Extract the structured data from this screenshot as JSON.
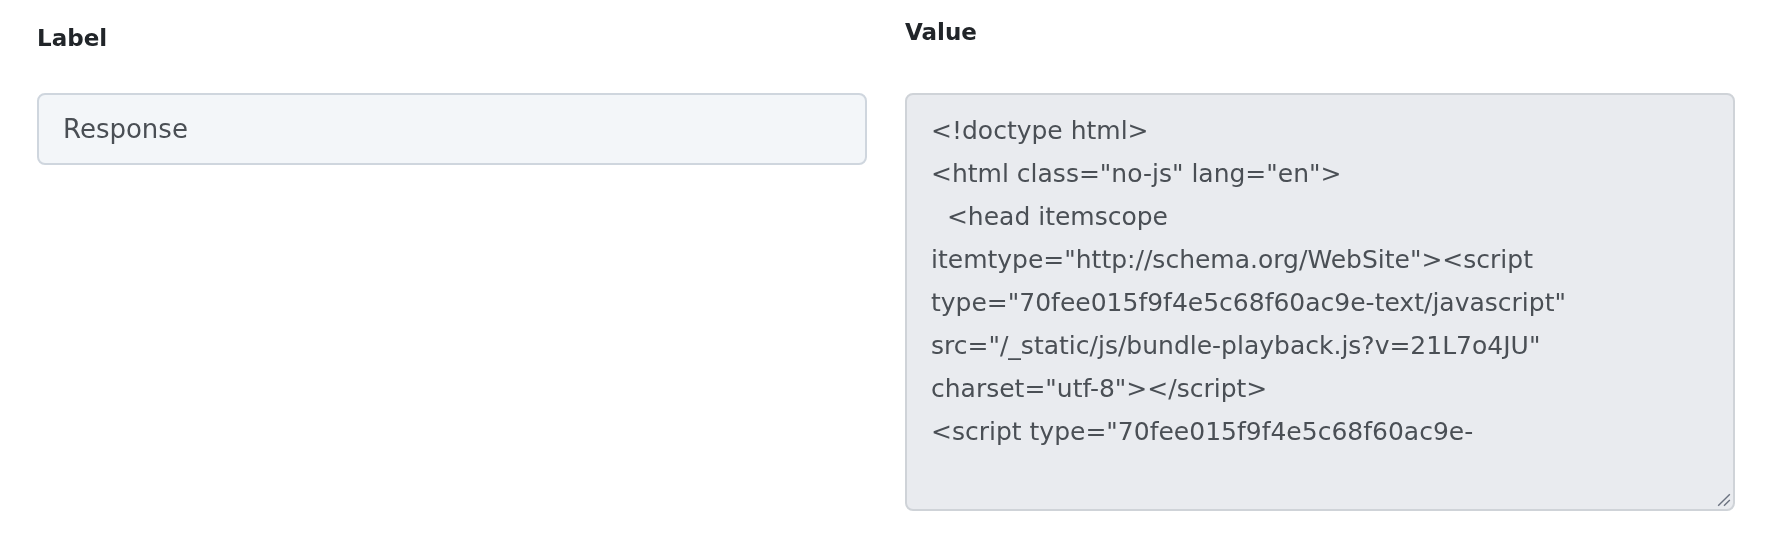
{
  "label_field": {
    "heading": "Label",
    "value": "Response"
  },
  "value_field": {
    "heading": "Value",
    "disabled": true,
    "lines": [
      "<!doctype html>",
      "<html class=\"no-js\" lang=\"en\">",
      "  <head itemscope",
      "itemtype=\"http://schema.org/WebSite\"><script",
      "type=\"70fee015f9f4e5c68f60ac9e-text/javascript\"",
      "src=\"/_static/js/bundle-playback.js?v=21L7o4JU\"",
      "charset=\"utf-8\"></script>",
      "<script type=\"70fee015f9f4e5c68f60ac9e-"
    ]
  }
}
